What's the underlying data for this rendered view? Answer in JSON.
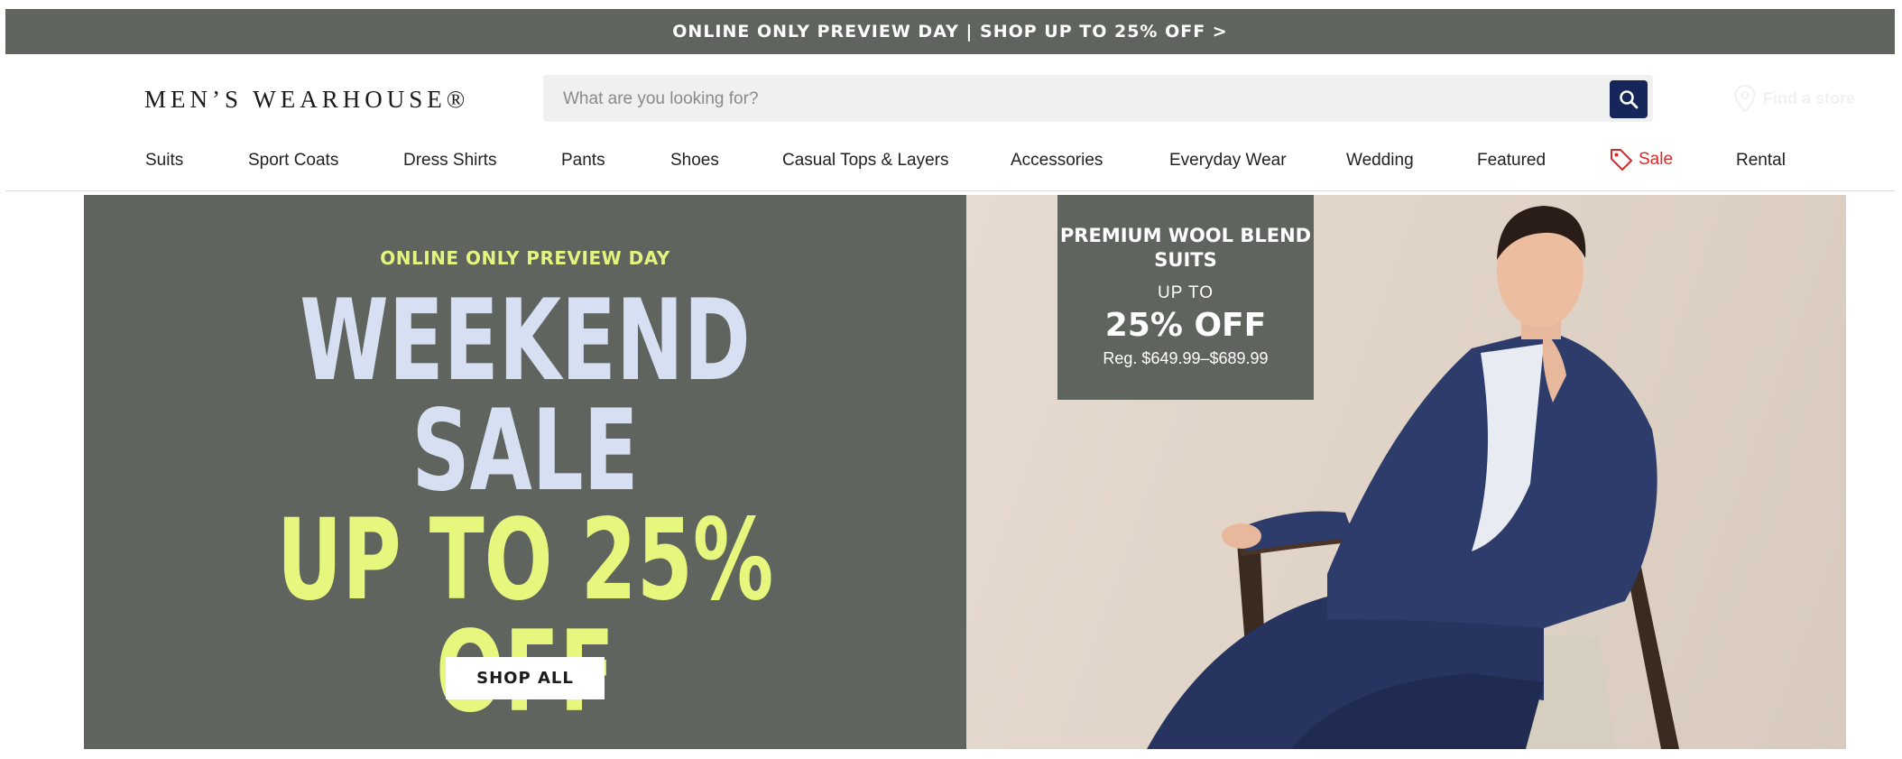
{
  "promo_bar": {
    "text": "ONLINE ONLY PREVIEW DAY | SHOP UP TO 25% OFF >"
  },
  "header": {
    "logo": "MEN’S WEARHOUSE®",
    "search": {
      "placeholder": "What are you looking for?",
      "value": ""
    },
    "find_store": "Find a store"
  },
  "nav": {
    "items": [
      "Suits",
      "Sport Coats",
      "Dress Shirts",
      "Pants",
      "Shoes",
      "Casual Tops & Layers",
      "Accessories",
      "Everyday Wear",
      "Wedding",
      "Featured",
      "Sale",
      "Rental"
    ],
    "sale_color": "#d52b2b"
  },
  "hero": {
    "eyebrow": "ONLINE ONLY PREVIEW DAY",
    "line1": "WEEKEND",
    "line2": "SALE",
    "line3": "UP TO 25% OFF",
    "cta": "SHOP ALL",
    "panel_color": "#60645e",
    "accent_color": "#e7f77d",
    "headline_color": "#d7e0f3"
  },
  "offer": {
    "title": "PREMIUM WOOL BLEND SUITS",
    "up_to": "UP TO",
    "discount": "25% OFF",
    "regular_price": "Reg. $649.99–$689.99"
  },
  "icons": {
    "search": "search-icon",
    "store": "location-pin-icon",
    "sale": "tag-icon"
  }
}
